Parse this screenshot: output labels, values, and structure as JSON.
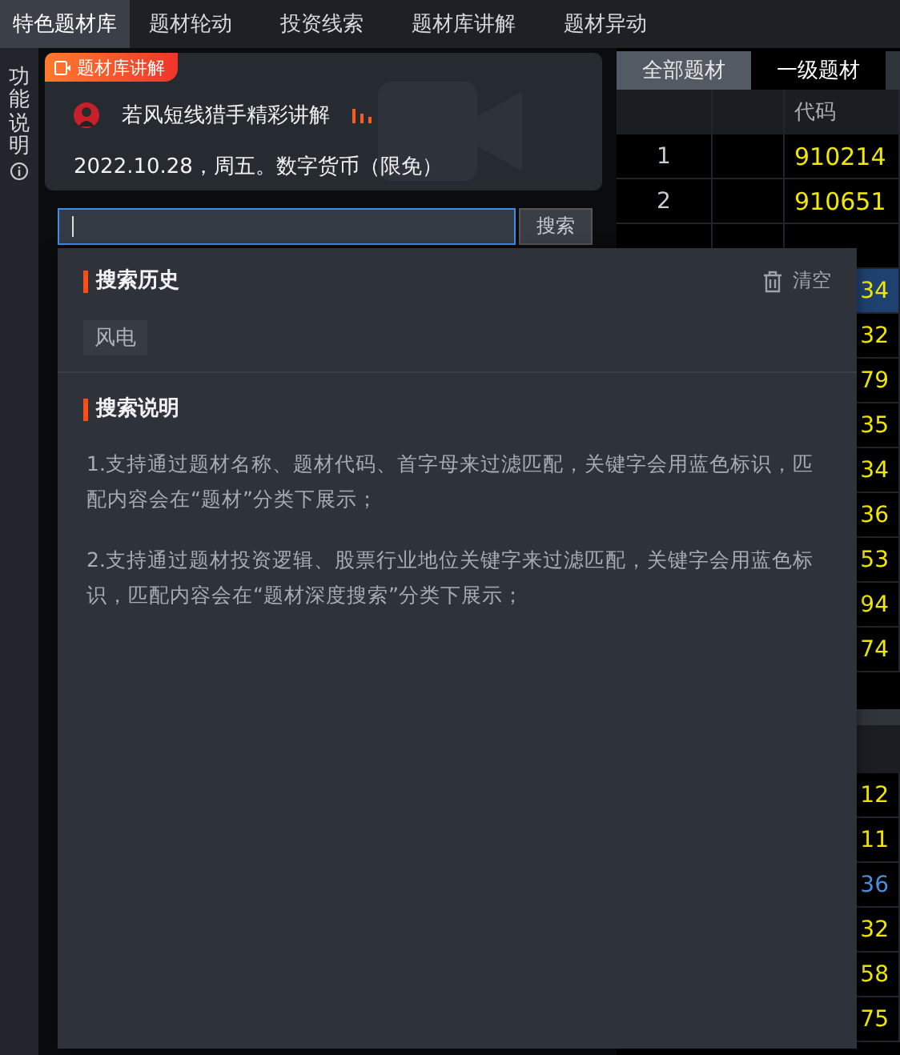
{
  "top_tabs": [
    {
      "label": "特色题材库",
      "selected": true
    },
    {
      "label": "题材轮动",
      "selected": false
    },
    {
      "label": "投资线索",
      "selected": false
    },
    {
      "label": "题材库讲解",
      "selected": false
    },
    {
      "label": "题材异动",
      "selected": false
    }
  ],
  "side_label": "功能说明",
  "lecture_card": {
    "badge": "题材库讲解",
    "title": "若风短线猎手精彩讲解",
    "subtitle": "2022.10.28，周五。数字货币（限免）"
  },
  "search": {
    "button": "搜索",
    "focused": true
  },
  "popup": {
    "history_title": "搜索历史",
    "clear": "清空",
    "history": [
      "风电"
    ],
    "help_title": "搜索说明",
    "help": [
      "1.支持通过题材名称、题材代码、首字母来过滤匹配，关键字会用蓝色标识，匹配内容会在“题材”分类下展示；",
      "2.支持通过题材投资逻辑、股票行业地位关键字来过滤匹配，关键字会用蓝色标识，匹配内容会在“题材深度搜索”分类下展示；"
    ]
  },
  "right_panel": {
    "tabs": [
      {
        "label": "全部题材",
        "selected": true
      },
      {
        "label": "一级题材",
        "selected": false
      }
    ],
    "column_3": "代码",
    "rows": [
      {
        "index": "1",
        "code": "910214",
        "color": "#f0e800",
        "selected": false
      },
      {
        "index": "2",
        "code": "910651",
        "color": "#f0e800",
        "selected": false
      },
      {
        "selected": false
      },
      {
        "code": "34",
        "color": "#f0e800",
        "selected": true
      },
      {
        "code": "32",
        "color": "#f0e800",
        "selected": false
      },
      {
        "code": "79",
        "color": "#f0e800",
        "selected": false
      },
      {
        "code": "35",
        "color": "#f0e800",
        "selected": false
      },
      {
        "code": "34",
        "color": "#f0e800",
        "selected": false
      },
      {
        "code": "36",
        "color": "#f0e800",
        "selected": false
      },
      {
        "code": "53",
        "color": "#f0e800",
        "selected": false
      },
      {
        "code": "94",
        "color": "#f0e800",
        "selected": false
      },
      {
        "code": "74",
        "color": "#f0e800",
        "selected": false
      }
    ],
    "rows_2": [
      {
        "code": "12",
        "color": "#f0e800"
      },
      {
        "code": "11",
        "color": "#f0e800"
      },
      {
        "code": "36",
        "color": "#4a90e2"
      },
      {
        "code": "32",
        "color": "#f0e800"
      },
      {
        "code": "58",
        "color": "#f0e800"
      },
      {
        "code": "75",
        "color": "#f0e800"
      }
    ]
  }
}
